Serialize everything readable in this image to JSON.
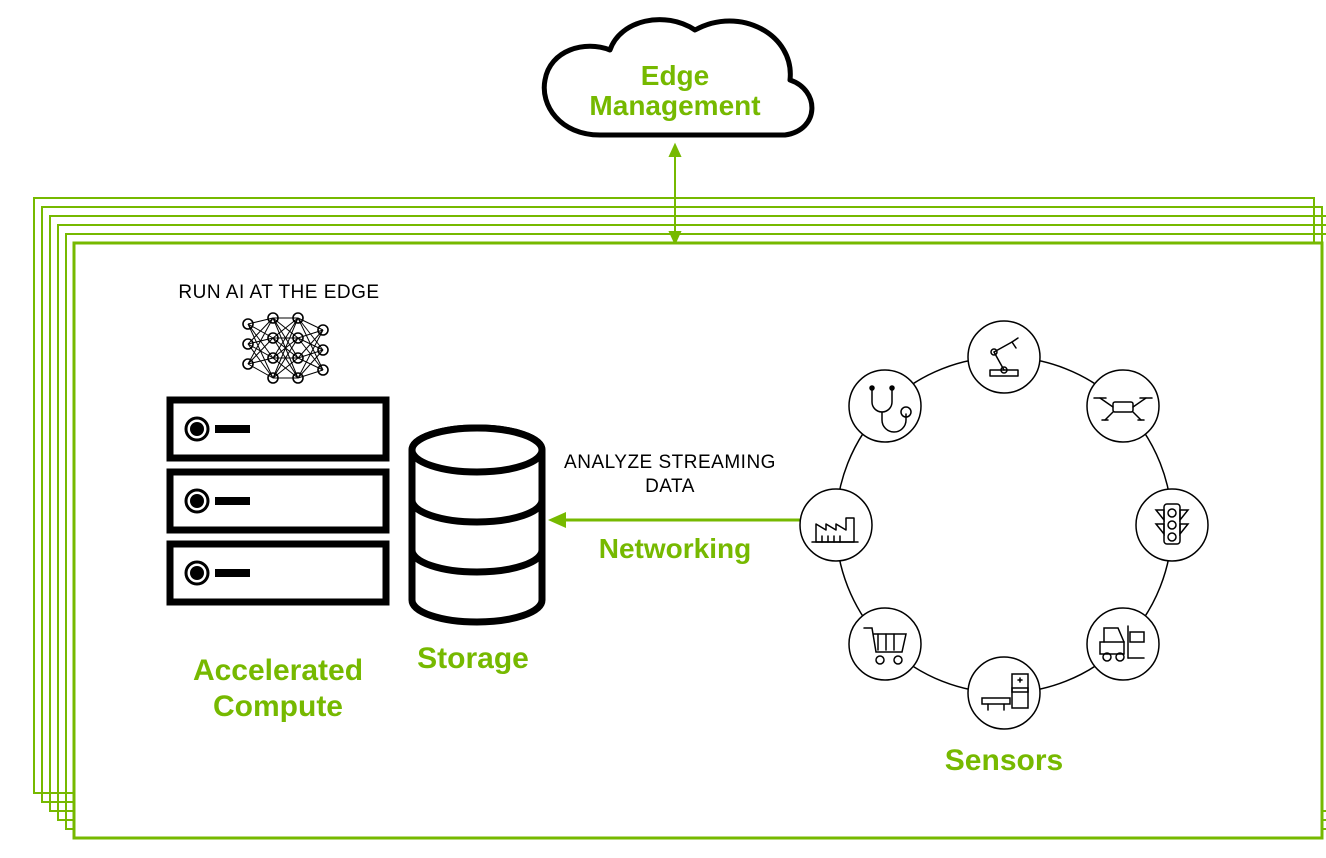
{
  "colors": {
    "accent": "#76b900",
    "black": "#000000"
  },
  "cloud": {
    "line1": "Edge",
    "line2": "Management"
  },
  "edge_label": "RUN AI AT THE EDGE",
  "compute_label_line1": "Accelerated",
  "compute_label_line2": "Compute",
  "storage_label": "Storage",
  "networking_label": "Networking",
  "analyze_label_line1": "ANALYZE STREAMING",
  "analyze_label_line2": "DATA",
  "sensors_label": "Sensors",
  "sensor_icons": [
    "robot-arm-icon",
    "drone-icon",
    "traffic-light-icon",
    "forklift-icon",
    "medical-scanner-icon",
    "shopping-cart-icon",
    "factory-icon",
    "stethoscope-icon"
  ]
}
